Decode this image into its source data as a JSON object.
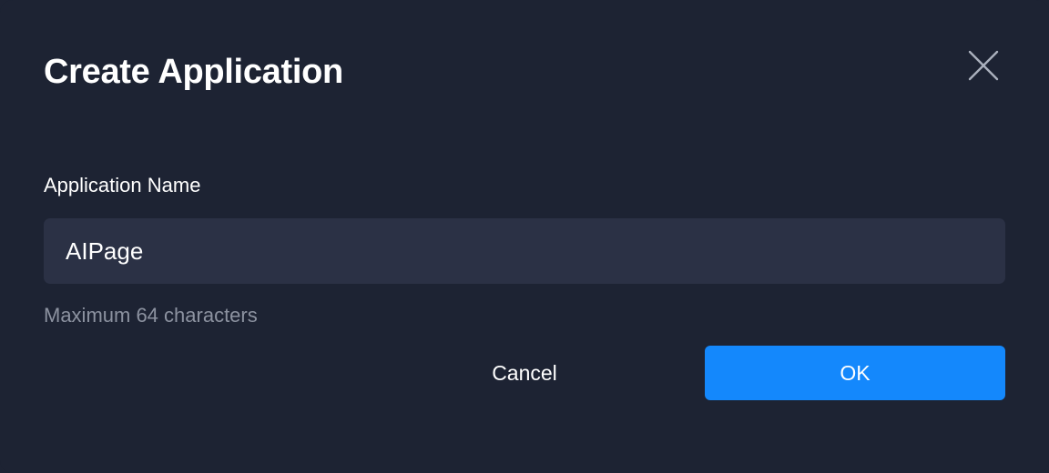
{
  "dialog": {
    "title": "Create Application",
    "close_icon": "close-icon"
  },
  "form": {
    "name_label": "Application Name",
    "name_value": "AIPage",
    "name_hint": "Maximum 64 characters"
  },
  "actions": {
    "cancel_label": "Cancel",
    "ok_label": "OK"
  },
  "colors": {
    "background": "#1d2333",
    "input_background": "#2b3145",
    "primary": "#1488fc",
    "hint_text": "#8c92a0"
  }
}
